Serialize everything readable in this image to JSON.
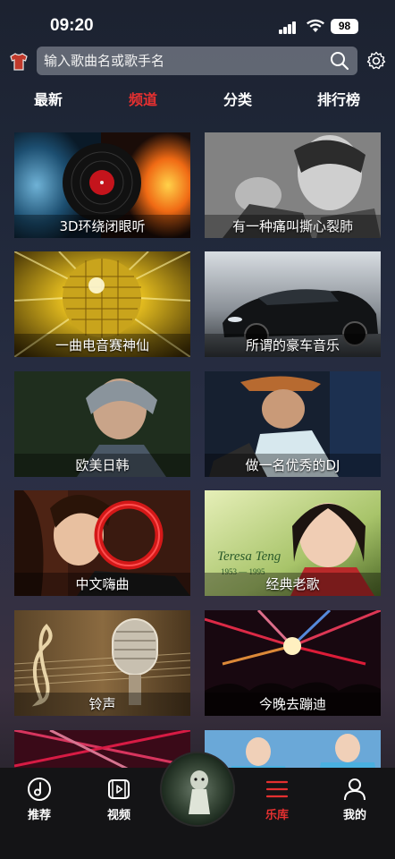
{
  "status": {
    "time": "09:20",
    "battery": "98"
  },
  "search": {
    "placeholder": "输入歌曲名或歌手名"
  },
  "tabs": [
    {
      "label": "最新",
      "active": false
    },
    {
      "label": "频道",
      "active": true
    },
    {
      "label": "分类",
      "active": false
    },
    {
      "label": "排行榜",
      "active": false
    }
  ],
  "cards": [
    {
      "label": "3D环绕闭眼听"
    },
    {
      "label": "有一种痛叫撕心裂肺"
    },
    {
      "label": "一曲电音赛神仙"
    },
    {
      "label": "所谓的豪车音乐"
    },
    {
      "label": "欧美日韩"
    },
    {
      "label": "做一名优秀的DJ"
    },
    {
      "label": "中文嗨曲"
    },
    {
      "label": "经典老歌"
    },
    {
      "label": "铃声"
    },
    {
      "label": "今晚去蹦迪"
    },
    {
      "label": ""
    },
    {
      "label": ""
    }
  ],
  "card_art_text": {
    "teresa": "Teresa Teng",
    "years": "1953 — 1995"
  },
  "nav": [
    {
      "label": "推荐",
      "icon": "music-note-disc-icon"
    },
    {
      "label": "视频",
      "icon": "video-icon"
    },
    {
      "label": "乐库",
      "icon": "library-lines-icon",
      "active": true
    },
    {
      "label": "我的",
      "icon": "user-icon"
    }
  ],
  "colors": {
    "accent": "#e53030",
    "nav_bg": "#141416"
  }
}
